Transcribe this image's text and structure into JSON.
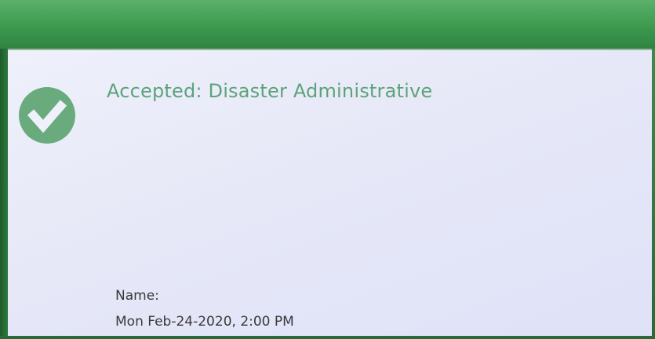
{
  "status": {
    "icon": "check-circle-icon",
    "title": "Accepted: Disaster Administrative"
  },
  "details": {
    "name_label": "Name:",
    "datetime": "Mon Feb-24-2020, 2:00 PM"
  },
  "colors": {
    "accent": "#5da37a",
    "header": "#3d9a4f",
    "screen_bg": "#e6e8f8",
    "text": "#3a3a3a"
  }
}
